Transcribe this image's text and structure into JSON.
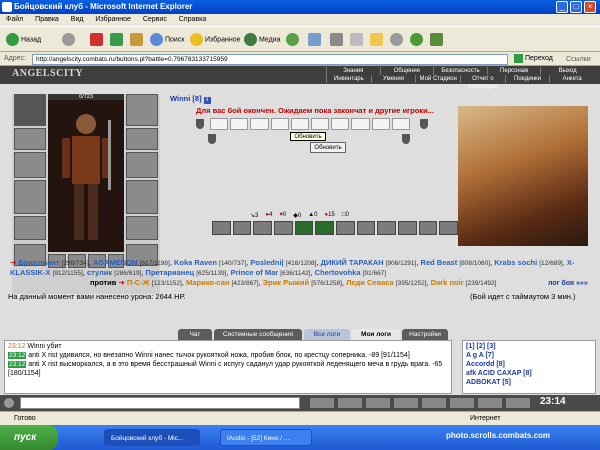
{
  "window": {
    "title": "Бойцовский клуб - Microsoft Internet Explorer"
  },
  "menu": [
    "Файл",
    "Правка",
    "Вид",
    "Избранное",
    "Сервис",
    "Справка"
  ],
  "toolbar": {
    "back": "Назад",
    "search": "Поиск",
    "favorites": "Избранное",
    "media": "Медиа"
  },
  "address": {
    "label": "Адрес:",
    "url": "http://angelscity.combats.ru/buttons.pl?battle=0.796783133715959",
    "go": "Переход",
    "links": "Ссылки"
  },
  "site": {
    "logo": "ANGELSCITY",
    "nav_top": [
      "Знания",
      "Общение",
      "Безопасность",
      "Персонаж",
      "Выход"
    ],
    "nav_bottom": [
      "Инвентарь",
      "Умения",
      "Мой Стадион",
      "Отчет о переводах",
      "Поединки",
      "Анкета"
    ]
  },
  "inventory": {
    "hp_text": "0/723",
    "hp_fraction": 0.0
  },
  "battle": {
    "player_name": "Winni [8]",
    "message": "Для вас бой окончен. Ожидаем пока закончат и другие игроки...",
    "tooltip": "Обновить",
    "refresh": "Обновить",
    "stats": [
      "3",
      "4",
      "0",
      "0",
      "0",
      "15",
      "0"
    ]
  },
  "team1": [
    {
      "name": "Бриллиант",
      "level": "[298/734]"
    },
    {
      "name": "AGAMENON",
      "level": "[617/1198]"
    },
    {
      "name": "Koka Raven",
      "level": "[140/737]"
    },
    {
      "name": "Posledni|",
      "level": "[416/1208]"
    },
    {
      "name": "ДИКИЙ ТАРАКАН",
      "level": "[906/1291]"
    },
    {
      "name": "Red Beast",
      "level": "[808/1060]"
    },
    {
      "name": "Krabs sochi",
      "level": "[12/689]"
    },
    {
      "name": "X-KLASSIK-X",
      "level": "[912/1155]"
    },
    {
      "name": "стулик",
      "level": "[286/619]"
    },
    {
      "name": "Претарианец",
      "level": "[625/1139]"
    },
    {
      "name": "Prince of Mar",
      "level": "[636/1142]"
    },
    {
      "name": "Chertovohka",
      "level": "[91/667]"
    }
  ],
  "versus_label": "против",
  "team2": [
    {
      "name": "П-С-Ж",
      "level": "[123/1152]"
    },
    {
      "name": "Марико-сан",
      "level": "[423/867]"
    },
    {
      "name": "Эрик Рыжий",
      "level": "[576/1258]"
    },
    {
      "name": "Леди Севаса",
      "level": "[395/1252]"
    },
    {
      "name": "Dark noir",
      "level": "[239/1492]"
    }
  ],
  "log_link": "лог боя »»»",
  "damage": "На данный момент вами нанесено урона: 2644 HP.",
  "timeout": "(Бой идет с таймаутом 3 мин.)",
  "chat_tabs": [
    "Чат",
    "Системные сообщения",
    "Все логи",
    "Мои логи",
    "Настройки"
  ],
  "chat": [
    {
      "time": "23:12",
      "text": "Winni убит"
    },
    {
      "time": "23:12",
      "text": "anti X rist удивился, но внезапно Winni нанес тычок рукояткой ножа, пробив блок, по крестцу соперника. -89 [91/1154]"
    },
    {
      "time": "23:12",
      "text": "anti X rist высморкался, а в это время бесстрашный Winni с испугу саданул удар рукояткой леденящего меча в грудь врага. -65 [180/1154]"
    }
  ],
  "online": {
    "pages": "[1] [2] [3]",
    "players": [
      "A g A [7]",
      "Accordd [8]",
      "afk ACID CAXAP [8]",
      "ADBOKAT [5]"
    ]
  },
  "clock": "23:14",
  "status": {
    "left": "Готово",
    "right": "Интернет"
  },
  "taskbar": {
    "start": "пуск",
    "tasks": [
      "Бойцовский клуб - Mic...",
      "tAudio - [52] Кино / ..."
    ],
    "watermark": "photo.scrolls.combats.com"
  },
  "colors": {
    "accent": "#0a5fe0",
    "page_bg": "#dedede",
    "header_bg": "#3e3e3e",
    "link": "#2b5fb8",
    "enemy_name": "#c77c00"
  }
}
